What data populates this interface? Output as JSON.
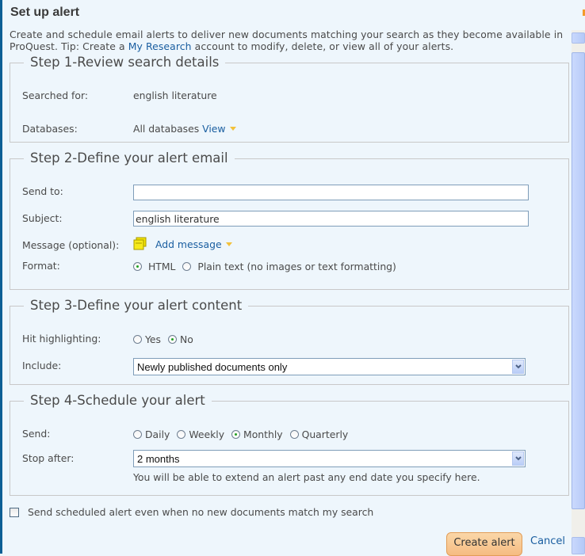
{
  "dialog": {
    "title": "Set up alert",
    "intro_part1": "Create and schedule email alerts to deliver new documents matching your search as they become available in ProQuest. Tip: Create a ",
    "intro_link": "My Research",
    "intro_part2": " account to modify, delete, or view all of your alerts."
  },
  "step1": {
    "legend": "Step 1-Review search details",
    "searched_for_label": "Searched for:",
    "searched_for_value": "english literature",
    "databases_label": "Databases:",
    "databases_value": "All databases",
    "view_link": "View"
  },
  "step2": {
    "legend": "Step 2-Define your alert email",
    "send_to_label": "Send to:",
    "send_to_value": "",
    "subject_label": "Subject:",
    "subject_value": "english literature",
    "message_label": "Message (optional):",
    "add_message_link": "Add message",
    "format_label": "Format:",
    "format_options": [
      {
        "label": "HTML",
        "checked": true
      },
      {
        "label": "Plain text (no images or text formatting)",
        "checked": false
      }
    ]
  },
  "step3": {
    "legend": "Step 3-Define your alert content",
    "hit_highlighting_label": "Hit highlighting:",
    "hit_options": [
      {
        "label": "Yes",
        "checked": false
      },
      {
        "label": "No",
        "checked": true
      }
    ],
    "include_label": "Include:",
    "include_value": "Newly published documents only"
  },
  "step4": {
    "legend": "Step 4-Schedule your alert",
    "send_label": "Send:",
    "send_options": [
      {
        "label": "Daily",
        "checked": false
      },
      {
        "label": "Weekly",
        "checked": false
      },
      {
        "label": "Monthly",
        "checked": true
      },
      {
        "label": "Quarterly",
        "checked": false
      }
    ],
    "stop_after_label": "Stop after:",
    "stop_after_value": "2 months",
    "stop_after_note": "You will be able to extend an alert past any end date you specify here."
  },
  "footer": {
    "send_even_if_empty_label": "Send scheduled alert even when no new documents match my search",
    "send_even_if_empty_checked": false,
    "create_button": "Create alert",
    "cancel_link": "Cancel"
  },
  "colors": {
    "accent_link": "#1a5ea0",
    "create_button": "#f6bc82",
    "background": "#eef6fc",
    "left_border": "#0d5f95"
  }
}
